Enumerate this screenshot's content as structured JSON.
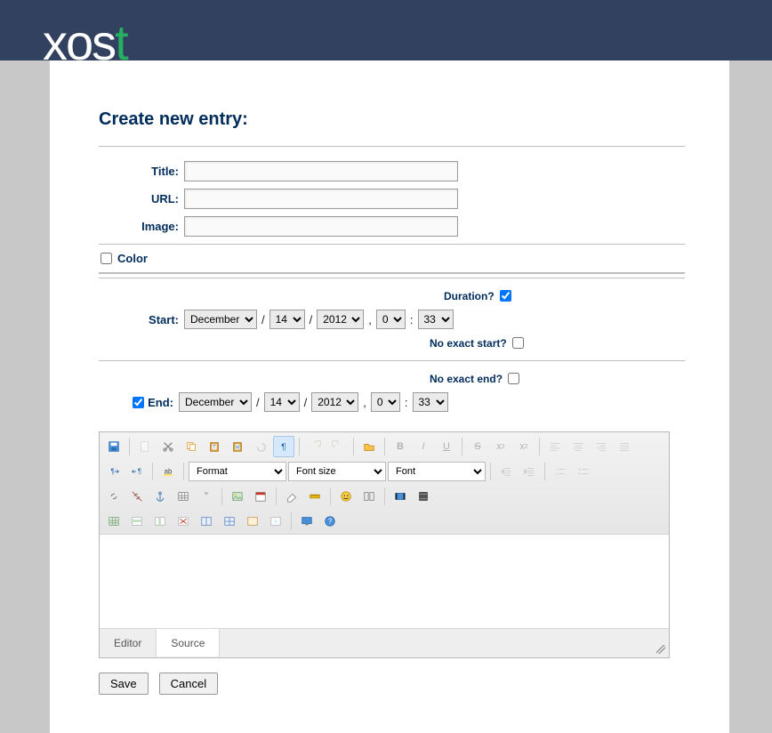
{
  "logo": {
    "prefix": "xos",
    "suffix": "t"
  },
  "page": {
    "title": "Create new entry:"
  },
  "form": {
    "title_label": "Title:",
    "url_label": "URL:",
    "image_label": "Image:",
    "color_label": "Color",
    "duration_label": "Duration?",
    "no_exact_start": "No exact start?",
    "no_exact_end": "No exact end?",
    "start_label": "Start:",
    "end_label": "End",
    "end_colon": ":"
  },
  "date": {
    "month": "December",
    "day": "14",
    "year": "2012",
    "hour": "0",
    "min": "33"
  },
  "editor": {
    "format": "Format",
    "fontsize": "Font size",
    "font": "Font",
    "tab_editor": "Editor",
    "tab_source": "Source"
  },
  "buttons": {
    "save": "Save",
    "cancel": "Cancel"
  }
}
